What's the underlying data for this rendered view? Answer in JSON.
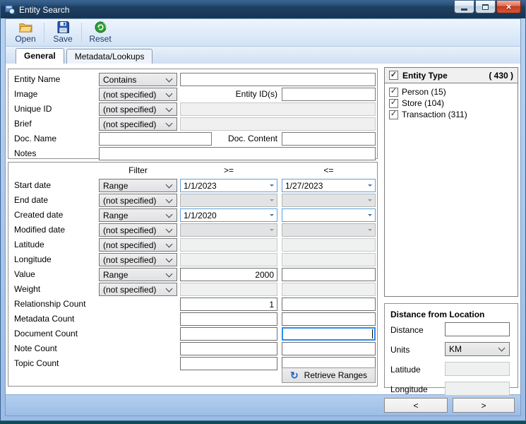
{
  "window": {
    "title": "Entity Search"
  },
  "toolbar": {
    "buttons": [
      {
        "label": "Open"
      },
      {
        "label": "Save"
      },
      {
        "label": "Reset"
      }
    ]
  },
  "tabs": [
    {
      "label": "General",
      "selected": true
    },
    {
      "label": "Metadata/Lookups",
      "selected": false
    }
  ],
  "top_form": {
    "entity_name": {
      "label": "Entity Name",
      "operator": "Contains",
      "value": ""
    },
    "image": {
      "label": "Image",
      "operator": "(not specified)"
    },
    "entity_ids": {
      "label": "Entity ID(s)",
      "value": ""
    },
    "unique_id": {
      "label": "Unique ID",
      "operator": "(not specified)",
      "value": ""
    },
    "brief": {
      "label": "Brief",
      "operator": "(not specified)",
      "value": ""
    },
    "doc_name": {
      "label": "Doc. Name",
      "value": ""
    },
    "doc_content": {
      "label": "Doc. Content",
      "value": ""
    },
    "notes": {
      "label": "Notes",
      "value": ""
    }
  },
  "filter_section": {
    "headers": {
      "filter": "Filter",
      "from": ">=",
      "to": "<="
    },
    "rows": [
      {
        "label": "Start date",
        "filter": "Range",
        "kind": "date",
        "enabled": true,
        "from": "1/1/2023",
        "to": "1/27/2023"
      },
      {
        "label": "End date",
        "filter": "(not specified)",
        "kind": "date",
        "enabled": false,
        "from": "",
        "to": ""
      },
      {
        "label": "Created date",
        "filter": "Range",
        "kind": "date",
        "enabled": true,
        "from": "1/1/2020",
        "to": ""
      },
      {
        "label": "Modified date",
        "filter": "(not specified)",
        "kind": "date",
        "enabled": false,
        "from": "",
        "to": ""
      },
      {
        "label": "Latitude",
        "filter": "(not specified)",
        "kind": "num",
        "enabled": false,
        "from": "",
        "to": ""
      },
      {
        "label": "Longitude",
        "filter": "(not specified)",
        "kind": "num",
        "enabled": false,
        "from": "",
        "to": ""
      },
      {
        "label": "Value",
        "filter": "Range",
        "kind": "num",
        "enabled": true,
        "from": "2000",
        "to": ""
      },
      {
        "label": "Weight",
        "filter": "(not specified)",
        "kind": "num",
        "enabled": false,
        "from": "",
        "to": ""
      },
      {
        "label": "Relationship Count",
        "filter": null,
        "kind": "num",
        "enabled": true,
        "from": "1",
        "to": ""
      },
      {
        "label": "Metadata Count",
        "filter": null,
        "kind": "num",
        "enabled": true,
        "from": "",
        "to": ""
      },
      {
        "label": "Document Count",
        "filter": null,
        "kind": "num",
        "enabled": true,
        "from": "",
        "to": "",
        "to_focused": true
      },
      {
        "label": "Note Count",
        "filter": null,
        "kind": "num",
        "enabled": true,
        "from": "",
        "to": ""
      },
      {
        "label": "Topic Count",
        "filter": null,
        "kind": "num",
        "enabled": true,
        "from": "",
        "to": ""
      }
    ],
    "retrieve_button": {
      "label": "Retrieve Ranges"
    }
  },
  "entity_type": {
    "title": "Entity Type",
    "count": "( 430 )",
    "header_checked": true,
    "items": [
      {
        "label": "Person (15)",
        "checked": true
      },
      {
        "label": "Store (104)",
        "checked": true
      },
      {
        "label": "Transaction (311)",
        "checked": true
      }
    ]
  },
  "distance_panel": {
    "title": "Distance from Location",
    "distance_label": "Distance",
    "distance_value": "",
    "units_label": "Units",
    "units_value": "KM",
    "latitude_label": "Latitude",
    "latitude_value": "",
    "longitude_label": "Longitude",
    "longitude_value": ""
  },
  "nav": {
    "prev": "<",
    "next": ">"
  },
  "icons": {
    "check": "✓",
    "refresh": "↻",
    "close": "×"
  },
  "colors": {
    "titlebar": "#1d3c5e",
    "window_frame": "#a6c3ea",
    "date_picker_border": "#5f9fd8",
    "focus_border": "#2d8ceb",
    "close_button": "#c23a20",
    "toolbar_label": "#1d3e6b"
  }
}
